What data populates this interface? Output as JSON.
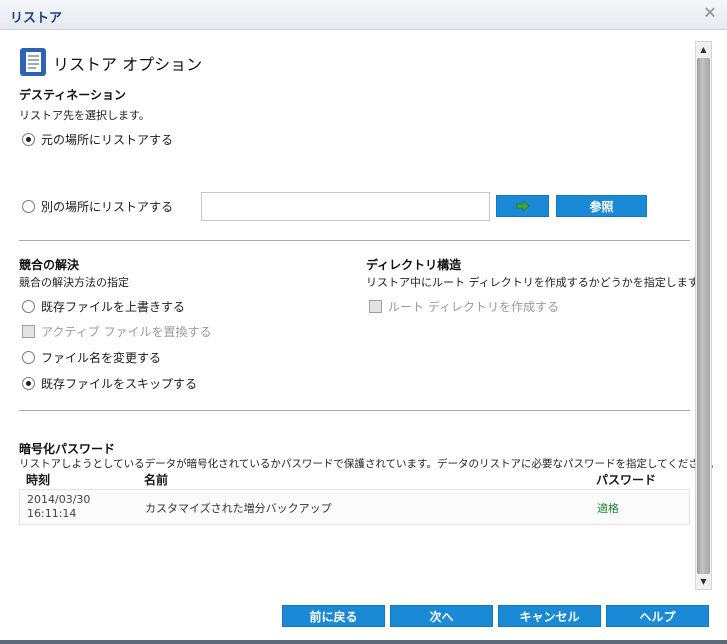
{
  "window": {
    "title": "リストア",
    "close_glyph": "✕"
  },
  "header": {
    "title": "リストア オプション",
    "icon": "document-icon"
  },
  "destination": {
    "title": "デスティネーション",
    "description": "リストア先を選択します。",
    "options": [
      {
        "label": "元の場所にリストアする",
        "selected": true
      },
      {
        "label": "別の場所にリストアする",
        "selected": false
      }
    ],
    "path_value": "",
    "go_icon": "arrow-right-icon",
    "browse_label": "参照"
  },
  "conflict": {
    "title": "競合の解決",
    "description": "競合の解決方法の指定",
    "options": [
      {
        "label": "既存ファイルを上書きする",
        "type": "radio",
        "selected": false,
        "enabled": true
      },
      {
        "label": "アクティブ ファイルを置換する",
        "type": "checkbox",
        "checked": false,
        "enabled": false
      },
      {
        "label": "ファイル名を変更する",
        "type": "radio",
        "selected": false,
        "enabled": true
      },
      {
        "label": "既存ファイルをスキップする",
        "type": "radio",
        "selected": true,
        "enabled": true
      }
    ]
  },
  "directory": {
    "title": "ディレクトリ構造",
    "description": "リストア中にルート ディレクトリを作成するかどうかを指定します。",
    "option": {
      "label": "ルート ディレクトリを作成する",
      "checked": false,
      "enabled": false
    }
  },
  "encryption": {
    "title": "暗号化パスワード",
    "description": "リストアしようとしているデータが暗号化されているかパスワードで保護されています。データのリストアに必要なパスワードを指定してください。",
    "columns": [
      "時刻",
      "名前",
      "パスワード"
    ],
    "rows": [
      {
        "time": "2014/03/30\n16:11:14",
        "name": "カスタマイズされた増分バックアップ",
        "password": "適格"
      }
    ]
  },
  "footer": {
    "back_label": "前に戻る",
    "next_label": "次へ",
    "cancel_label": "キャンセル",
    "help_label": "ヘルプ"
  },
  "colors": {
    "accent": "#1b8ad6",
    "title_text": "#1d3f7a",
    "status_ok": "#1c8a2e"
  }
}
